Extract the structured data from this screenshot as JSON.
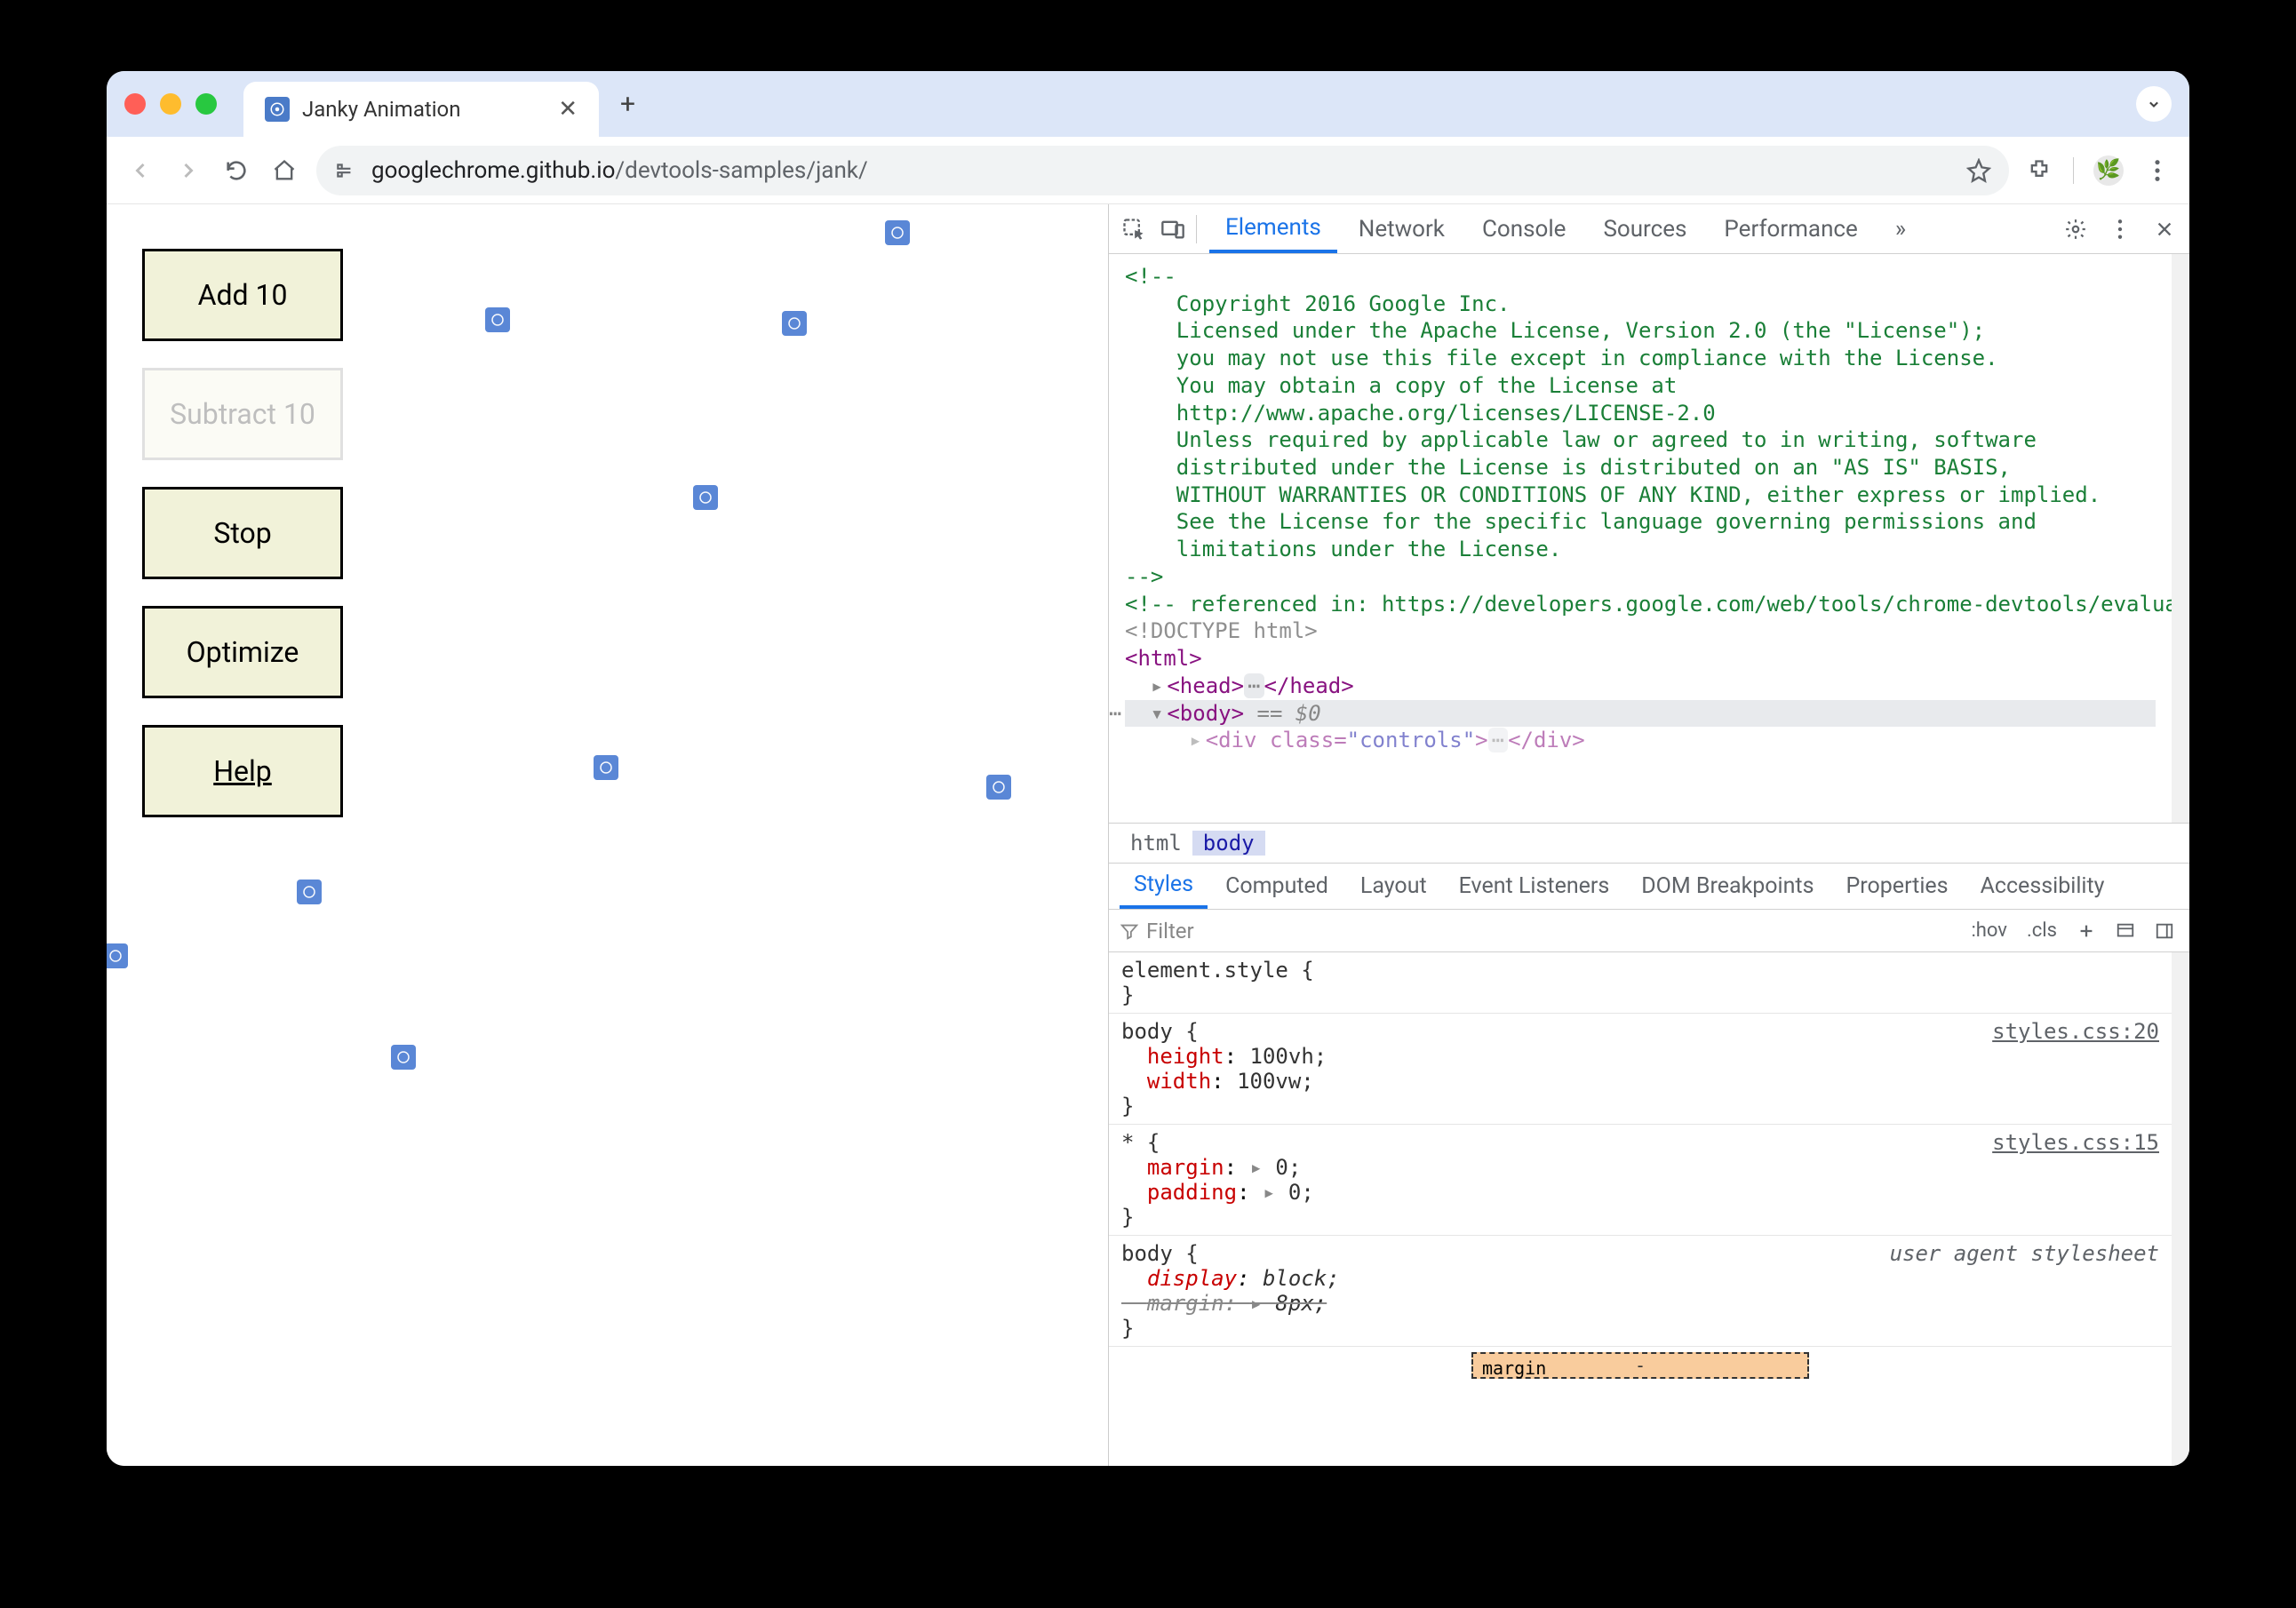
{
  "browser": {
    "tab_title": "Janky Animation",
    "url_host": "googlechrome.github.io",
    "url_path": "/devtools-samples/jank/"
  },
  "page": {
    "buttons": {
      "add": "Add 10",
      "subtract": "Subtract 10",
      "stop": "Stop",
      "optimize": "Optimize",
      "help": "Help"
    }
  },
  "devtools": {
    "tabs": [
      "Elements",
      "Network",
      "Console",
      "Sources",
      "Performance"
    ],
    "active_tab": "Elements",
    "more_tabs": "»",
    "elements_source": {
      "comment_lines": [
        "<!--",
        "    Copyright 2016 Google Inc.",
        "",
        "    Licensed under the Apache License, Version 2.0 (the \"License\");",
        "    you may not use this file except in compliance with the License.",
        "    You may obtain a copy of the License at",
        "",
        "    http://www.apache.org/licenses/LICENSE-2.0",
        "",
        "    Unless required by applicable law or agreed to in writing, software",
        "    distributed under the License is distributed on an \"AS IS\" BASIS,",
        "    WITHOUT WARRANTIES OR CONDITIONS OF ANY KIND, either express or implied.",
        "    See the License for the specific language governing permissions and",
        "    limitations under the License.",
        "-->",
        "<!-- referenced in: https://developers.google.com/web/tools/chrome-devtools/evaluate-performance/ -->"
      ],
      "doctype": "<!DOCTYPE html>",
      "html_open": "<html>",
      "head_line_open": "<head>",
      "head_line_close": "</head>",
      "body_open": "<body>",
      "body_eq0": " == $0",
      "child_div": "<div class=\"controls\">…</div>"
    },
    "breadcrumb": [
      "html",
      "body"
    ],
    "subtabs": [
      "Styles",
      "Computed",
      "Layout",
      "Event Listeners",
      "DOM Breakpoints",
      "Properties",
      "Accessibility"
    ],
    "active_subtab": "Styles",
    "filter_placeholder": "Filter",
    "style_chips": [
      ":hov",
      ".cls"
    ],
    "rules": {
      "element_style": {
        "selector": "element.style {",
        "close": "}"
      },
      "body1": {
        "selector": "body {",
        "source": "styles.css:20",
        "props": [
          {
            "name": "height",
            "value": "100vh;"
          },
          {
            "name": "width",
            "value": "100vw;"
          }
        ],
        "close": "}"
      },
      "star": {
        "selector": "* {",
        "source": "styles.css:15",
        "props": [
          {
            "name": "margin",
            "value": "0;",
            "tri": true
          },
          {
            "name": "padding",
            "value": "0;",
            "tri": true
          }
        ],
        "close": "}"
      },
      "ua_body": {
        "selector": "body {",
        "source": "user agent stylesheet",
        "props_html": [
          {
            "name": "display",
            "value": "block;",
            "italic": true
          },
          {
            "name": "margin",
            "value": "8px;",
            "strike": true,
            "tri": true
          }
        ],
        "close": "}"
      }
    },
    "boxmodel": {
      "label": "margin",
      "top": "-"
    }
  }
}
